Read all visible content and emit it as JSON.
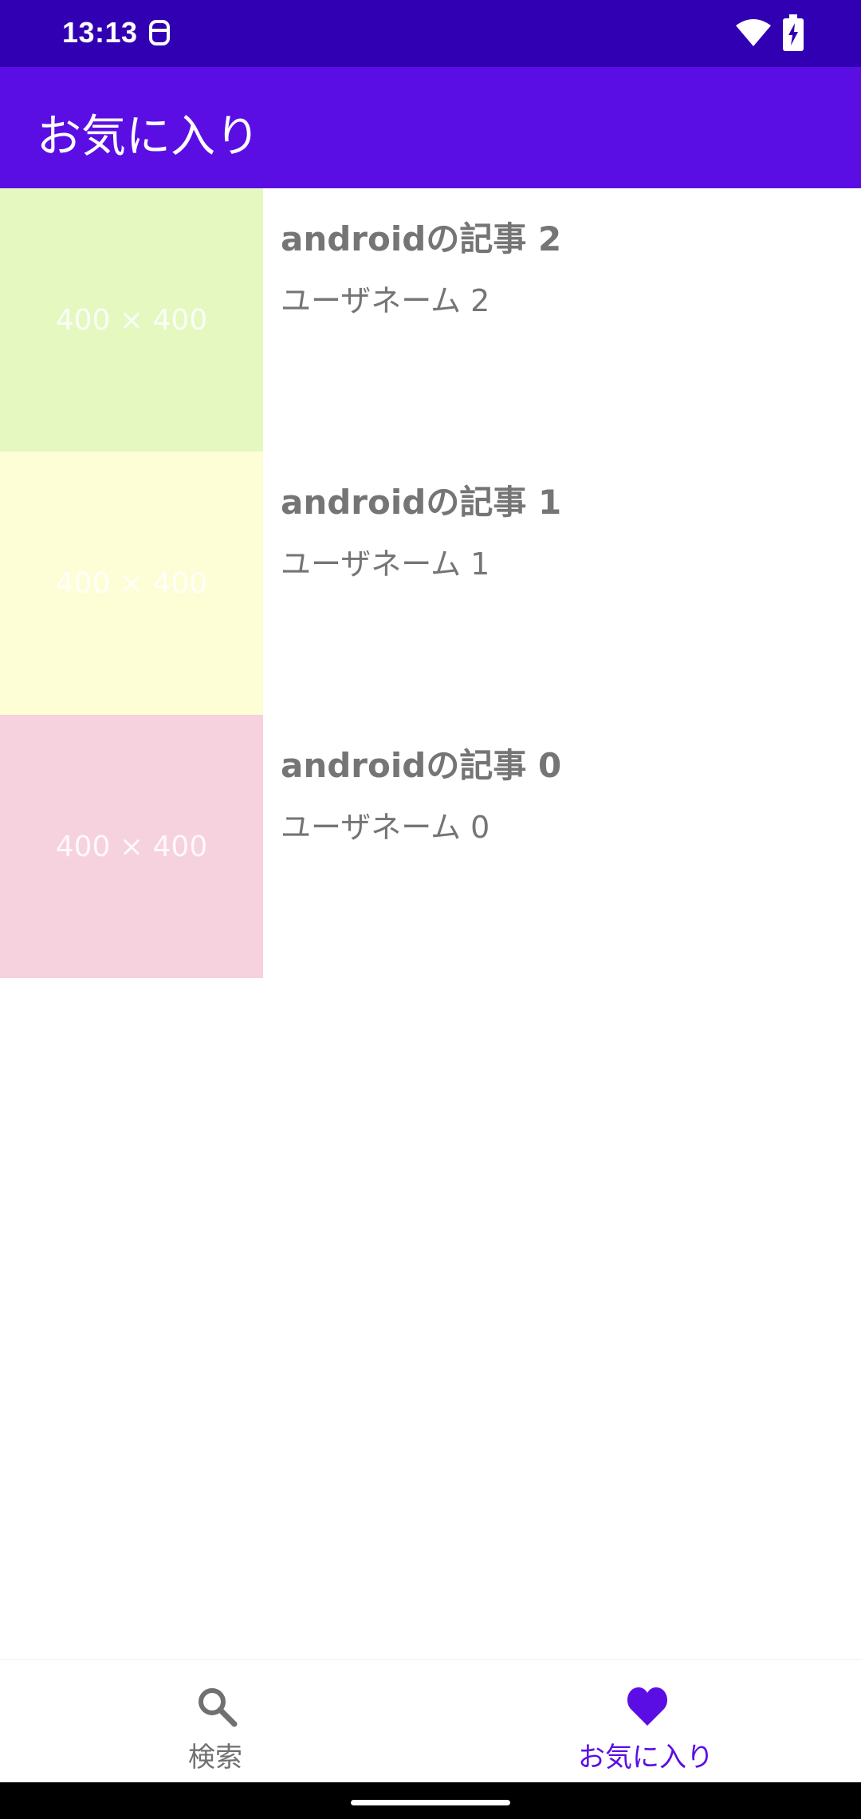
{
  "status_bar": {
    "time": "13:13",
    "background": "#3200b3",
    "icons": [
      "notification-icon",
      "wifi-icon",
      "battery-charging-icon"
    ]
  },
  "app_bar": {
    "title": "お気に入り",
    "background": "#5b0ee4"
  },
  "list": {
    "items": [
      {
        "title": "androidの記事 2",
        "user": "ユーザネーム 2",
        "thumb_text": "400 × 400",
        "thumb_color": "#e4f8c0"
      },
      {
        "title": "androidの記事 1",
        "user": "ユーザネーム 1",
        "thumb_text": "400 × 400",
        "thumb_color": "#fdfdd6"
      },
      {
        "title": "androidの記事 0",
        "user": "ユーザネーム 0",
        "thumb_text": "400 × 400",
        "thumb_color": "#f6d1de"
      }
    ]
  },
  "bottom_nav": {
    "items": [
      {
        "label": "検索",
        "icon": "search-icon",
        "active": false
      },
      {
        "label": "お気に入り",
        "icon": "heart-icon",
        "active": true
      }
    ],
    "active_color": "#5b0ee4",
    "inactive_color": "#707070"
  }
}
